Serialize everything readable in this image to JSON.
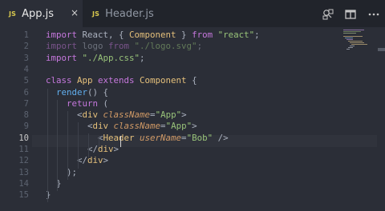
{
  "tabs": [
    {
      "badge": "JS",
      "label": "App.js",
      "active": true
    },
    {
      "badge": "JS",
      "label": "Header.js",
      "active": false
    }
  ],
  "tab_close": "×",
  "actions": [
    "open-changes-icon",
    "split-editor-icon",
    "more-actions-icon"
  ],
  "editor": {
    "current_line": 10,
    "lines": [
      {
        "n": "1",
        "tokens": [
          [
            "kw",
            "import "
          ],
          [
            "pun",
            "React, { "
          ],
          [
            "cls",
            "Component"
          ],
          [
            "pun",
            " } "
          ],
          [
            "kw",
            "from "
          ],
          [
            "str",
            "\"react\""
          ],
          [
            "pun",
            ";"
          ]
        ]
      },
      {
        "n": "2",
        "dim": true,
        "tokens": [
          [
            "kw",
            "import "
          ],
          [
            "pun",
            "logo "
          ],
          [
            "kw",
            "from "
          ],
          [
            "str",
            "\"./logo.svg\""
          ],
          [
            "pun",
            ";"
          ]
        ]
      },
      {
        "n": "3",
        "tokens": [
          [
            "kw",
            "import "
          ],
          [
            "str",
            "\"./App.css\""
          ],
          [
            "pun",
            ";"
          ]
        ]
      },
      {
        "n": "4",
        "tokens": []
      },
      {
        "n": "5",
        "tokens": [
          [
            "kw",
            "class "
          ],
          [
            "cls",
            "App "
          ],
          [
            "kw",
            "extends "
          ],
          [
            "cls",
            "Component "
          ],
          [
            "pun",
            "{"
          ]
        ]
      },
      {
        "n": "6",
        "tokens": [
          [
            "pun",
            "  "
          ],
          [
            "fn",
            "render"
          ],
          [
            "pun",
            "() {"
          ]
        ]
      },
      {
        "n": "7",
        "tokens": [
          [
            "pun",
            "    "
          ],
          [
            "kw",
            "return "
          ],
          [
            "pun",
            "("
          ]
        ]
      },
      {
        "n": "8",
        "tokens": [
          [
            "pun",
            "      <"
          ],
          [
            "tag",
            "div "
          ],
          [
            "attr",
            "className"
          ],
          [
            "pun",
            "="
          ],
          [
            "str",
            "\"App\""
          ],
          [
            "pun",
            ">"
          ]
        ]
      },
      {
        "n": "9",
        "tokens": [
          [
            "pun",
            "        <"
          ],
          [
            "tag",
            "div "
          ],
          [
            "attr",
            "className"
          ],
          [
            "pun",
            "="
          ],
          [
            "str",
            "\"App\""
          ],
          [
            "pun",
            ">"
          ]
        ]
      },
      {
        "n": "10",
        "tokens": [
          [
            "pun",
            "          <"
          ],
          [
            "tag",
            "Header "
          ],
          [
            "attr",
            "userName"
          ],
          [
            "pun",
            "="
          ],
          [
            "str",
            "\"Bob\""
          ],
          [
            "pun",
            " />"
          ]
        ]
      },
      {
        "n": "11",
        "tokens": [
          [
            "pun",
            "        </"
          ],
          [
            "tag",
            "div"
          ],
          [
            "pun",
            ">"
          ]
        ]
      },
      {
        "n": "12",
        "tokens": [
          [
            "pun",
            "      </"
          ],
          [
            "tag",
            "div"
          ],
          [
            "pun",
            ">"
          ]
        ]
      },
      {
        "n": "13",
        "tokens": [
          [
            "pun",
            "    );"
          ]
        ]
      },
      {
        "n": "14",
        "tokens": [
          [
            "pun",
            "  }"
          ]
        ]
      },
      {
        "n": "15",
        "tokens": [
          [
            "pun",
            "}"
          ]
        ]
      }
    ]
  },
  "colors": {
    "background": "#2b2e37",
    "tabbar": "#21242b",
    "keyword": "#c678dd",
    "string": "#98c379",
    "class": "#e5c07b",
    "function": "#61afef",
    "attribute": "#d19a66"
  }
}
